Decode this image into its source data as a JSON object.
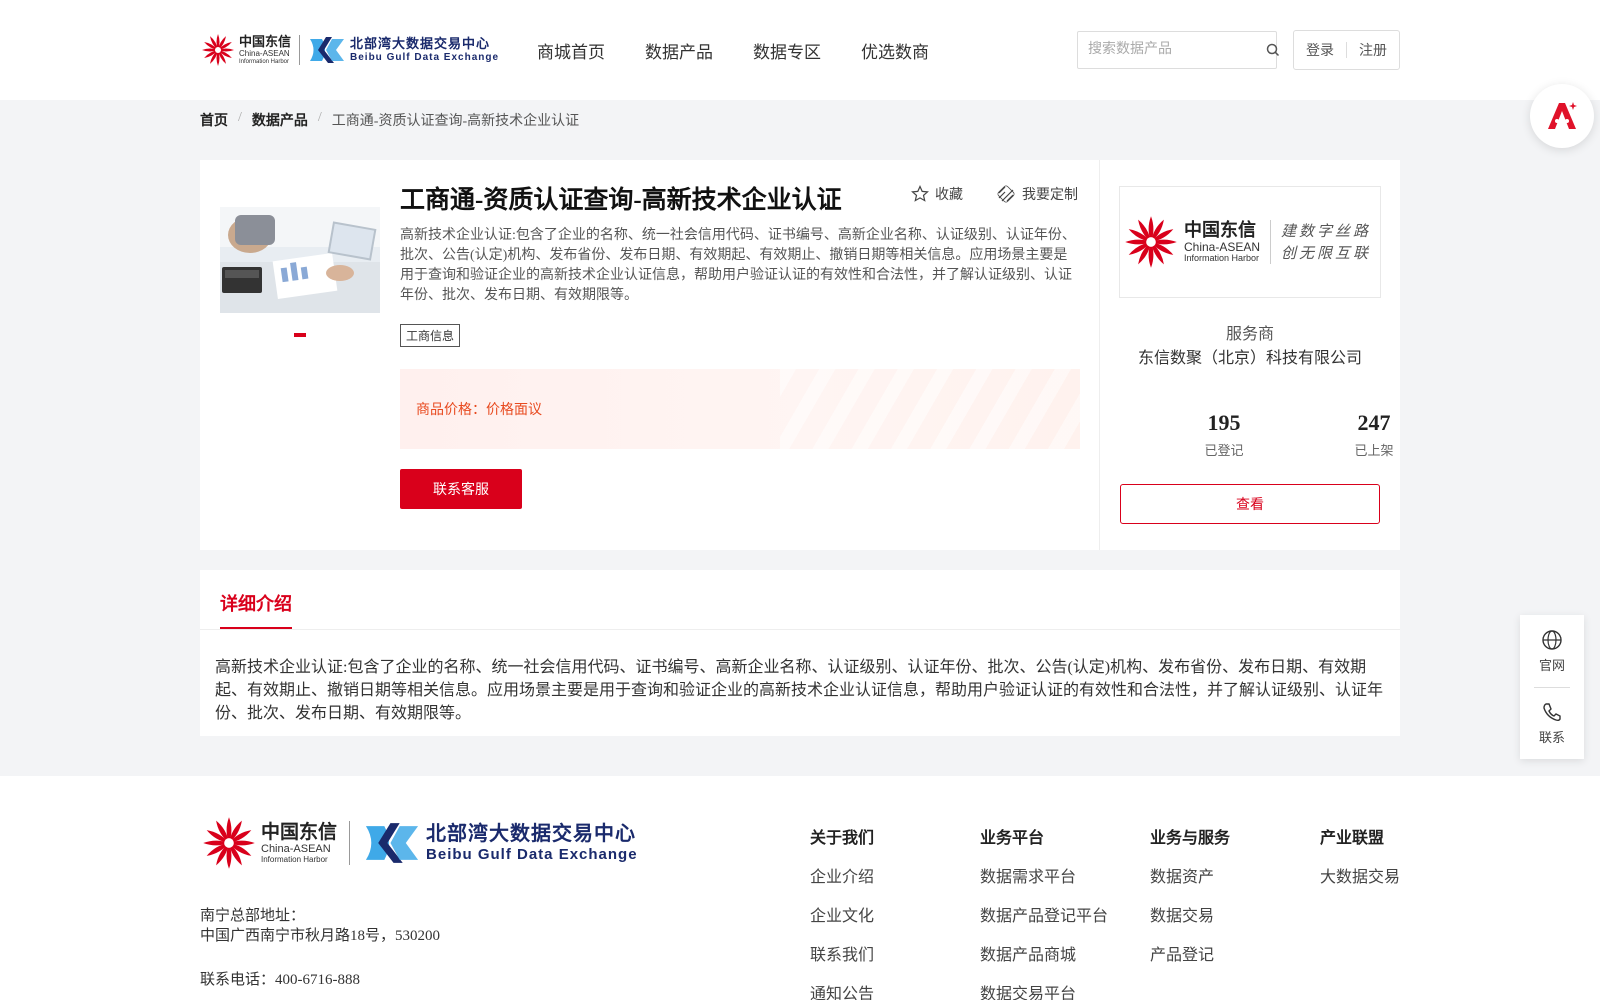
{
  "header": {
    "logo_dx": {
      "cn": "中国东信",
      "en1": "China-ASEAN",
      "en2": "Information Harbor"
    },
    "logo_bb": {
      "cn": "北部湾大数据交易中心",
      "en": "Beibu Gulf Data Exchange"
    },
    "nav": [
      "商城首页",
      "数据产品",
      "数据专区",
      "优选数商"
    ],
    "search_placeholder": "搜索数据产品",
    "login": "登录",
    "register": "注册"
  },
  "breadcrumb": {
    "home": "首页",
    "category": "数据产品",
    "current": "工商通-资质认证查询-高新技术企业认证",
    "sep": "/"
  },
  "product": {
    "title": "工商通-资质认证查询-高新技术企业认证",
    "favorite": "收藏",
    "customize": "我要定制",
    "description": "高新技术企业认证:包含了企业的名称、统一社会信用代码、证书编号、高新企业名称、认证级别、认证年份、批次、公告(认定)机构、发布省份、发布日期、有效期起、有效期止、撤销日期等相关信息。应用场景主要是用于查询和验证企业的高新技术企业认证信息，帮助用户验证认证的有效性和合法性，并了解认证级别、认证年份、批次、发布日期、有效期限等。",
    "tag": "工商信息",
    "price_label": "商品价格：",
    "price_value": "价格面议",
    "contact_button": "联系客服"
  },
  "vendor": {
    "logo_cn": "中国东信",
    "logo_en1": "China-ASEAN",
    "logo_en2": "Information Harbor",
    "slogan1": "建数字丝路",
    "slogan2": "创无限互联",
    "label": "服务商",
    "name": "东信数聚（北京）科技有限公司",
    "registered_count": "195",
    "registered_label": "已登记",
    "listed_count": "247",
    "listed_label": "已上架",
    "view_button": "查看"
  },
  "detail": {
    "tab": "详细介绍",
    "text": "高新技术企业认证:包含了企业的名称、统一社会信用代码、证书编号、高新企业名称、认证级别、认证年份、批次、公告(认定)机构、发布省份、发布日期、有效期起、有效期止、撤销日期等相关信息。应用场景主要是用于查询和验证企业的高新技术企业认证信息，帮助用户验证认证的有效性和合法性，并了解认证级别、认证年份、批次、发布日期、有效期限等。"
  },
  "side": {
    "website": "官网",
    "contact": "联系"
  },
  "footer": {
    "address_label": "南宁总部地址：",
    "address": "中国广西南宁市秋月路18号，530200",
    "phone": "联系电话：400-6716-888",
    "columns": [
      {
        "title": "关于我们",
        "items": [
          "企业介绍",
          "企业文化",
          "联系我们",
          "通知公告"
        ]
      },
      {
        "title": "业务平台",
        "items": [
          "数据需求平台",
          "数据产品登记平台",
          "数据产品商城",
          "数据交易平台"
        ]
      },
      {
        "title": "业务与服务",
        "items": [
          "数据资产",
          "数据交易",
          "产品登记"
        ]
      },
      {
        "title": "产业联盟",
        "items": [
          "大数据交易"
        ]
      }
    ]
  },
  "colors": {
    "brand_red": "#d9001b",
    "price_orange": "#e84a1f",
    "bb_blue": "#1a2a6c"
  },
  "icons": [
    "search-icon",
    "star-icon",
    "customize-icon",
    "globe-icon",
    "phone-icon",
    "ai-badge-icon"
  ]
}
